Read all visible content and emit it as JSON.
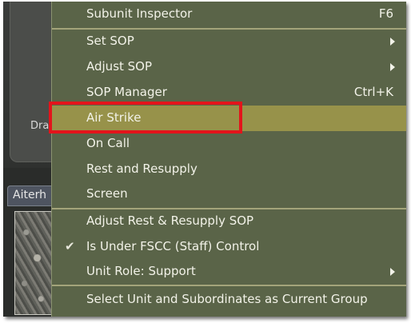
{
  "background": {
    "left_panel_text": "Dra",
    "tab_label": "Aiterh"
  },
  "menu": {
    "items": [
      {
        "label": "Subunit Inspector",
        "shortcut": "F6"
      },
      {
        "label": "Set SOP",
        "submenu": true
      },
      {
        "label": "Adjust SOP",
        "submenu": true
      },
      {
        "label": "SOP Manager",
        "shortcut": "Ctrl+K"
      },
      {
        "label": "Air Strike",
        "highlighted": true
      },
      {
        "label": "On Call"
      },
      {
        "label": "Rest and Resupply"
      },
      {
        "label": "Screen"
      },
      {
        "label": "Adjust Rest & Resupply SOP"
      },
      {
        "label": "Is Under FSCC (Staff) Control",
        "checked": true
      },
      {
        "label": "Unit Role: Support",
        "submenu": true
      },
      {
        "label": "Select Unit and Subordinates as Current Group"
      }
    ]
  },
  "colors": {
    "menu_background": "#5a6448",
    "highlight": "#97924a",
    "callout_border": "#e3141b"
  }
}
